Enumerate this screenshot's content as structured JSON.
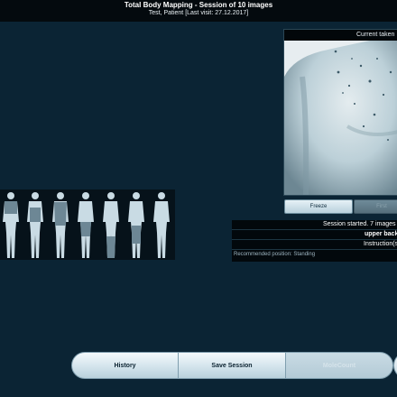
{
  "header": {
    "title": "Total Body Mapping - Session of 10 images",
    "subtitle": "Test, Patient [Last visit: 27.12.2017]"
  },
  "preview": {
    "header_label": "Current taken",
    "freeze_label": "Freeze",
    "first_button_label": "First"
  },
  "session_info": {
    "status": "Session started.   7 images",
    "area": "upper back",
    "instruction": "Instruction(s)",
    "recommended": "Recommended position: Standing"
  },
  "toolbar": {
    "history_label": "History",
    "save_session_label": "Save Session",
    "molecount_label": "MoleCount"
  },
  "bodymaps": {
    "figures": [
      {
        "name": "figure-1",
        "highlight": "upper-back"
      },
      {
        "name": "figure-2",
        "highlight": "chest"
      },
      {
        "name": "figure-3",
        "highlight": "abdomen"
      },
      {
        "name": "figure-4",
        "highlight": "thighs"
      },
      {
        "name": "figure-5",
        "highlight": "lower-legs"
      },
      {
        "name": "figure-6",
        "highlight": "legs"
      },
      {
        "name": "figure-7",
        "highlight": "none"
      }
    ]
  },
  "colors": {
    "background": "#0b2434",
    "header": "#040a0e",
    "button_gradient_top": "#f4f9fb",
    "button_gradient_bottom": "#b9d1dc",
    "figure": "#c9dbe4",
    "figure_highlight": "#6d8795"
  }
}
